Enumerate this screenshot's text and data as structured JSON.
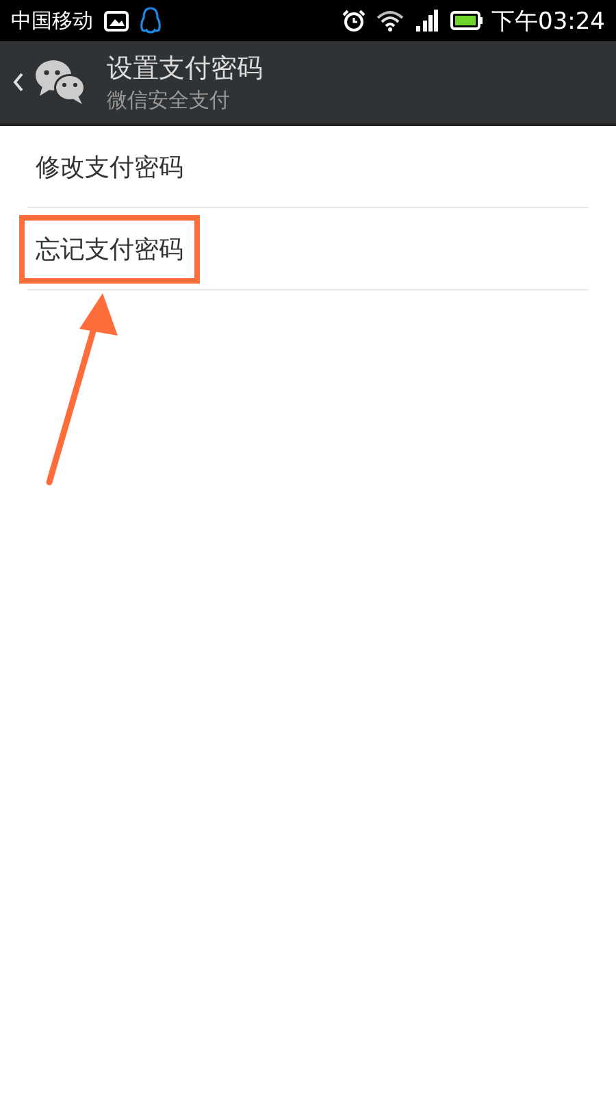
{
  "status_bar": {
    "carrier": "中国移动",
    "time": "下午03:24"
  },
  "header": {
    "title": "设置支付密码",
    "subtitle": "微信安全支付"
  },
  "items": [
    {
      "label": "修改支付密码",
      "highlighted": false
    },
    {
      "label": "忘记支付密码",
      "highlighted": true
    }
  ]
}
